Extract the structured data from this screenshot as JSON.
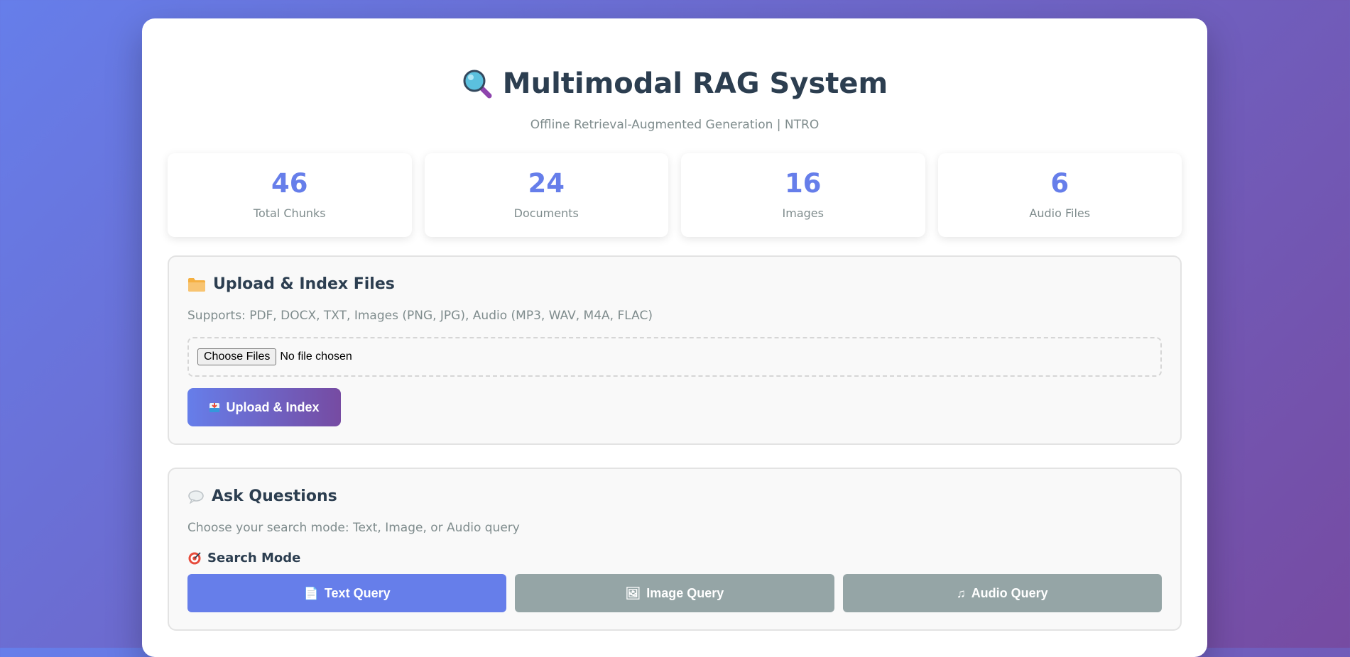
{
  "header": {
    "title": "Multimodal RAG System",
    "subtitle": "Offline Retrieval-Augmented Generation | NTRO",
    "icon": "magnifier-icon"
  },
  "stats": [
    {
      "value": "46",
      "label": "Total Chunks"
    },
    {
      "value": "24",
      "label": "Documents"
    },
    {
      "value": "16",
      "label": "Images"
    },
    {
      "value": "6",
      "label": "Audio Files"
    }
  ],
  "upload": {
    "icon": "folder-icon",
    "title": "Upload & Index Files",
    "supports": "Supports: PDF, DOCX, TXT, Images (PNG, JPG), Audio (MP3, WAV, M4A, FLAC)",
    "choose_label": "Choose Files",
    "file_status": "No file chosen",
    "button_label": "Upload & Index",
    "button_icon": "inbox-tray-icon"
  },
  "ask": {
    "icon": "speech-bubble-icon",
    "title": "Ask Questions",
    "description": "Choose your search mode: Text, Image, or Audio query",
    "mode_title": "Search Mode",
    "mode_icon": "target-icon",
    "modes": [
      {
        "label": "Text Query",
        "icon": "document-icon",
        "active": true
      },
      {
        "label": "Image Query",
        "icon": "picture-icon",
        "active": false
      },
      {
        "label": "Audio Query",
        "icon": "music-note-icon",
        "active": false
      }
    ]
  },
  "colors": {
    "accent": "#667eea",
    "gradient_end": "#764ba2",
    "inactive": "#95a5a6",
    "text_dark": "#2c3e50",
    "text_muted": "#7f8c8d"
  }
}
